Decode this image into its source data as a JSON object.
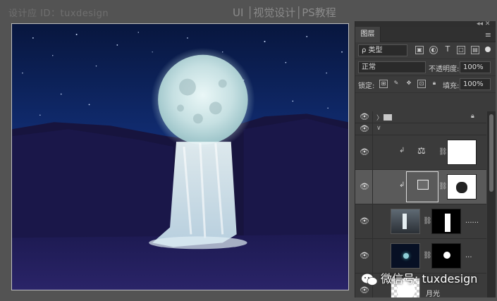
{
  "watermark": {
    "left": "设计应 ID：tuxdesign",
    "right": "UI │视觉设计│PS教程"
  },
  "panel": {
    "tab": "图层",
    "controls": "◂◂  ✕",
    "menu_icon": "≡",
    "filter": {
      "kind_label": "ρ 类型",
      "icons": [
        "image-filter-icon",
        "adjust-filter-icon",
        "type-filter-icon",
        "shape-filter-icon",
        "smart-filter-icon"
      ]
    },
    "blend": {
      "mode": "正常",
      "opacity_label": "不透明度:",
      "opacity_value": "100%"
    },
    "lock": {
      "label": "锁定:",
      "fill_label": "填充:",
      "fill_value": "100%"
    },
    "layers": [
      {
        "type": "group",
        "name": "",
        "expanded": false,
        "locked": true
      },
      {
        "type": "group-open",
        "name": ""
      },
      {
        "type": "adjustment",
        "icon": "balance-icon",
        "clipped": true,
        "mask": "white"
      },
      {
        "type": "adjustment",
        "icon": "levels-icon",
        "clipped": true,
        "selected": true,
        "mask": "blob"
      },
      {
        "type": "image",
        "thumb": "waterfall",
        "mask": "waterfall",
        "suffix": "......"
      },
      {
        "type": "image",
        "thumb": "moon-dark",
        "mask": "dot",
        "suffix": "..."
      },
      {
        "type": "image",
        "thumb": "moon-transparent",
        "name": "月光"
      }
    ]
  },
  "wechat": {
    "text": "微信号: tuxdesign"
  }
}
